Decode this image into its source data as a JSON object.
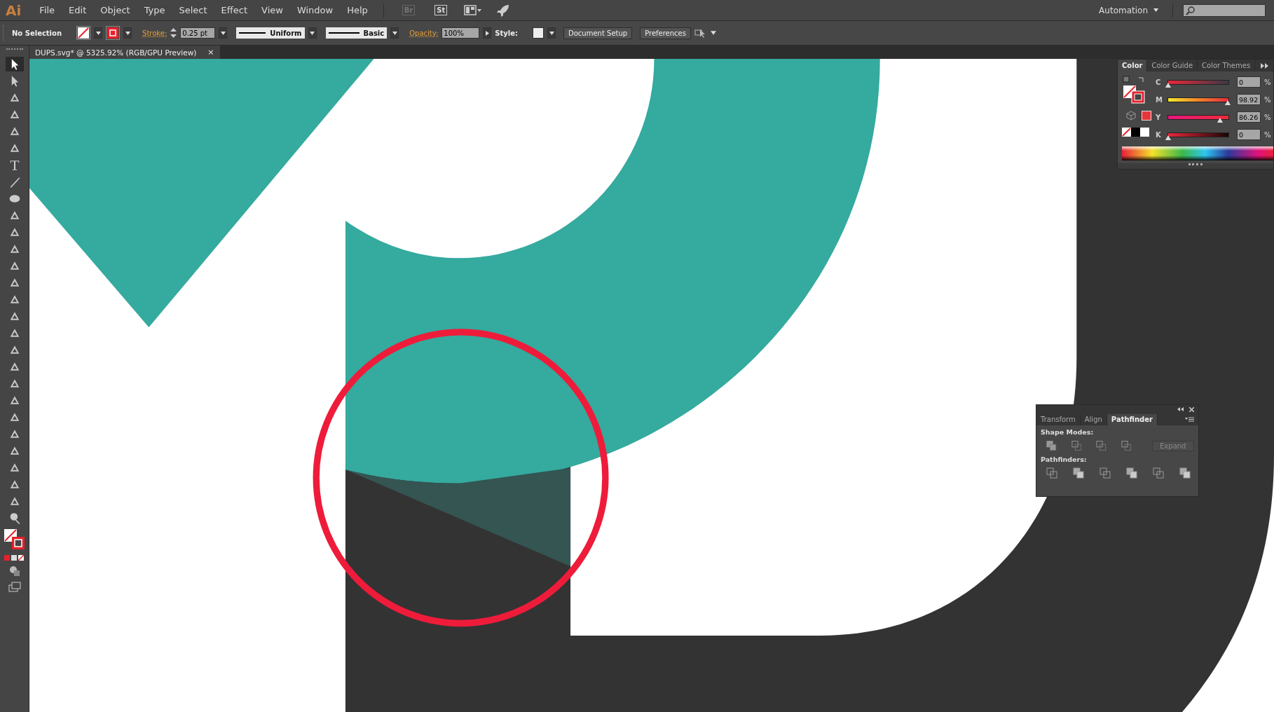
{
  "app_logo": "Ai",
  "menu": [
    "File",
    "Edit",
    "Object",
    "Type",
    "Select",
    "Effect",
    "View",
    "Window",
    "Help"
  ],
  "bridge_buttons": [
    "Br",
    "St"
  ],
  "workspace": "Automation",
  "control_bar": {
    "selection": "No Selection",
    "stroke_label": "Stroke:",
    "stroke_weight": "0.25 pt",
    "profile": "Uniform",
    "brush": "Basic",
    "opacity_label": "Opacity:",
    "opacity": "100%",
    "style_label": "Style:",
    "buttons": [
      "Document Setup",
      "Preferences"
    ]
  },
  "document_tab": {
    "title": "DUPS.svg* @ 5325.92% (RGB/GPU Preview)",
    "close": "×"
  },
  "color_panel": {
    "tabs": [
      {
        "label": "Color",
        "selected": true
      },
      {
        "label": "Color Guide",
        "selected": false
      },
      {
        "label": "Color Themes",
        "selected": false
      }
    ],
    "channels": [
      {
        "name": "C",
        "value": "0",
        "level": 0,
        "unit": "%"
      },
      {
        "name": "M",
        "value": "98.92",
        "level": 0.9892,
        "unit": "%"
      },
      {
        "name": "Y",
        "value": "86.26",
        "level": 0.8626,
        "unit": "%"
      },
      {
        "name": "K",
        "value": "0",
        "level": 0,
        "unit": "%"
      }
    ]
  },
  "pathfinder_panel": {
    "tabs": [
      {
        "label": "Transform",
        "selected": false
      },
      {
        "label": "Align",
        "selected": false
      },
      {
        "label": "Pathfinder",
        "selected": true
      }
    ],
    "shape_modes_label": "Shape Modes:",
    "expand": {
      "label": "Expand",
      "disabled": true
    },
    "pathfinders_label": "Pathfinders:"
  }
}
